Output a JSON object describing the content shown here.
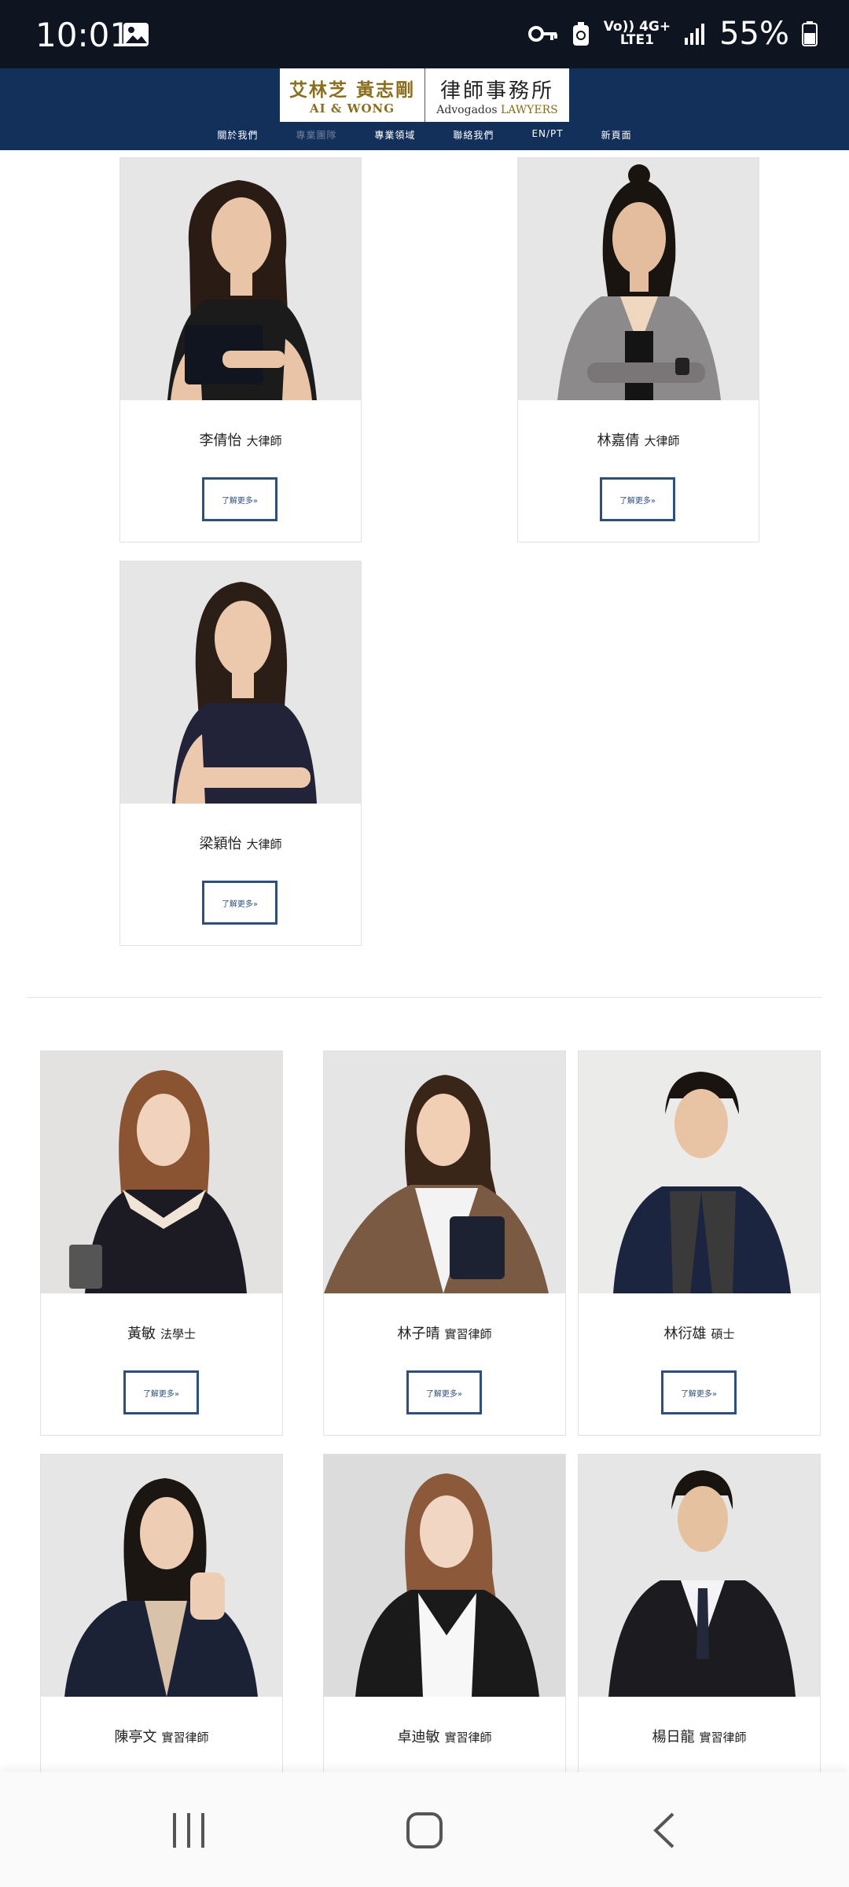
{
  "status_bar": {
    "time": "10:01",
    "network_top": "Vo)) 4G+",
    "network_bottom": "LTE1",
    "battery": "55%"
  },
  "header": {
    "logo_cn": "艾林芝 黃志剛",
    "logo_en": "AI & WONG",
    "logo_firm": "律師事務所",
    "logo_adv_prefix": "Advogados",
    "logo_adv_suffix": "LAWYERS",
    "nav": [
      "關於我們",
      "專業團隊",
      "專業領域",
      "聯絡我們",
      "EN/PT",
      "新頁面"
    ]
  },
  "more_label": "了解更多»",
  "lawyers": [
    {
      "name": "李倩怡",
      "title": "大律師"
    },
    {
      "name": "林嘉倩",
      "title": "大律師"
    },
    {
      "name": "梁穎怡",
      "title": "大律師"
    }
  ],
  "team": [
    {
      "name": "黃敏",
      "title": "法學士"
    },
    {
      "name": "林子晴",
      "title": "實習律師"
    },
    {
      "name": "林衍雄",
      "title": "碩士"
    },
    {
      "name": "陳亭文",
      "title": "實習律師"
    },
    {
      "name": "卓迪敏",
      "title": "實習律師"
    },
    {
      "name": "楊日龍",
      "title": "實習律師"
    }
  ],
  "colors": {
    "header_bg": "#13305a",
    "accent": "#2e4f7a",
    "logo_gold": "#8a6d1d"
  }
}
